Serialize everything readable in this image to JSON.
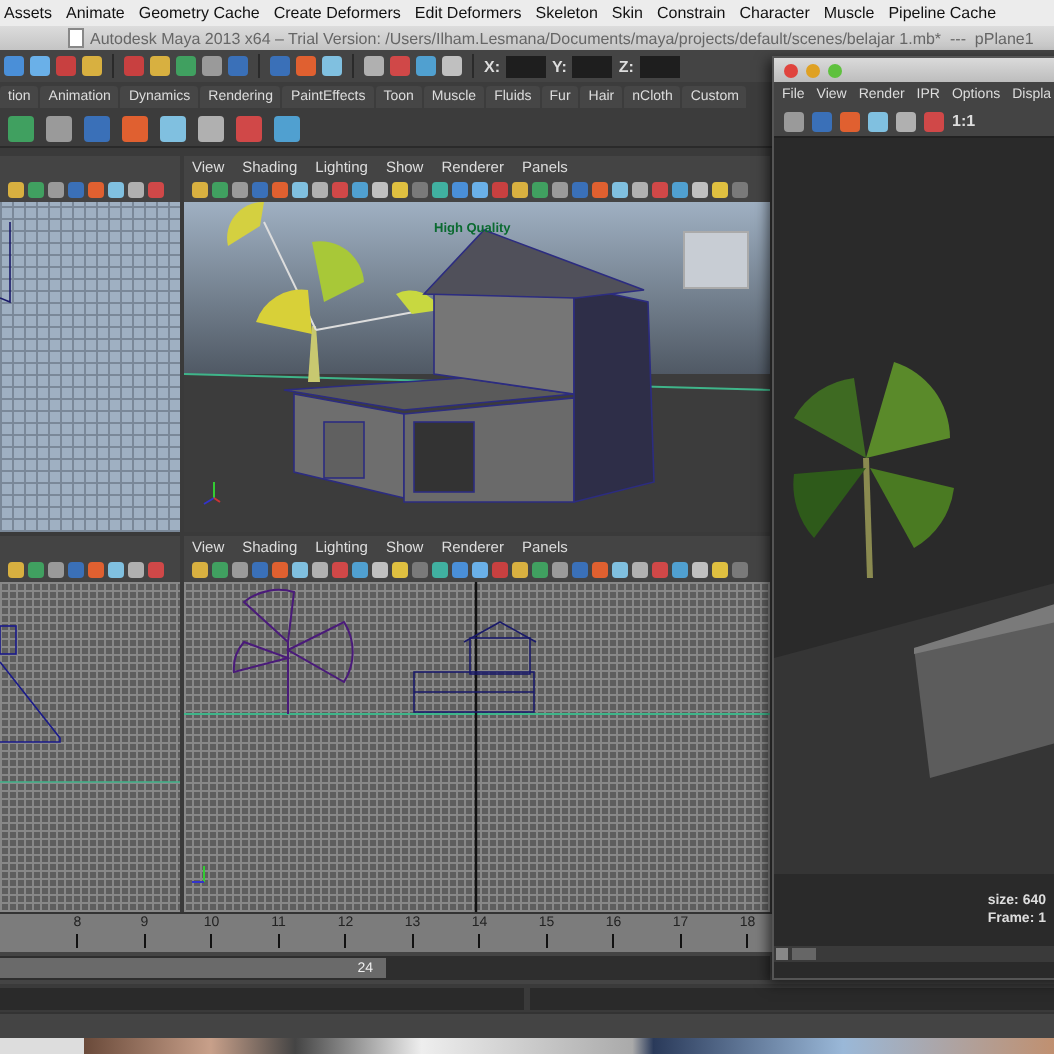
{
  "menu_bar": [
    "Assets",
    "Animate",
    "Geometry Cache",
    "Create Deformers",
    "Edit Deformers",
    "Skeleton",
    "Skin",
    "Constrain",
    "Character",
    "Muscle",
    "Pipeline Cache"
  ],
  "window_title": "Autodesk Maya 2013 x64 – Trial Version: /Users/Ilham.Lesmana/Documents/maya/projects/default/scenes/belajar 1.mb*  ---  pPlane1",
  "status_line": {
    "fields": [
      {
        "label": "X:"
      },
      {
        "label": "Y:"
      },
      {
        "label": "Z:"
      }
    ]
  },
  "shelf_tabs": [
    {
      "label": "tion",
      "selected": false
    },
    {
      "label": "Animation",
      "selected": false
    },
    {
      "label": "Dynamics",
      "selected": false
    },
    {
      "label": "Rendering",
      "selected": false
    },
    {
      "label": "PaintEffects",
      "selected": false
    },
    {
      "label": "Toon",
      "selected": false
    },
    {
      "label": "Muscle",
      "selected": false
    },
    {
      "label": "Fluids",
      "selected": false
    },
    {
      "label": "Fur",
      "selected": false
    },
    {
      "label": "Hair",
      "selected": false
    },
    {
      "label": "nCloth",
      "selected": false
    },
    {
      "label": "Custom",
      "selected": false
    }
  ],
  "panels": [
    {
      "kind": "side"
    },
    {
      "kind": "perspective",
      "menus": [
        "View",
        "Shading",
        "Lighting",
        "Show",
        "Renderer",
        "Panels"
      ],
      "hud": "High Quality"
    },
    {
      "kind": "side-grid"
    },
    {
      "kind": "front",
      "menus": [
        "View",
        "Shading",
        "Lighting",
        "Show",
        "Renderer",
        "Panels"
      ]
    }
  ],
  "time_slider": {
    "ticks": [
      "8",
      "9",
      "10",
      "11",
      "12",
      "13",
      "14",
      "15",
      "16",
      "17",
      "18"
    ]
  },
  "range_slider": {
    "end": "24",
    "level": 0.5
  },
  "render_view": {
    "menus": [
      "File",
      "View",
      "Render",
      "IPR",
      "Options",
      "Displa"
    ],
    "zoom_label": "1:1",
    "info": [
      "size: 640",
      "Frame: 1"
    ]
  }
}
